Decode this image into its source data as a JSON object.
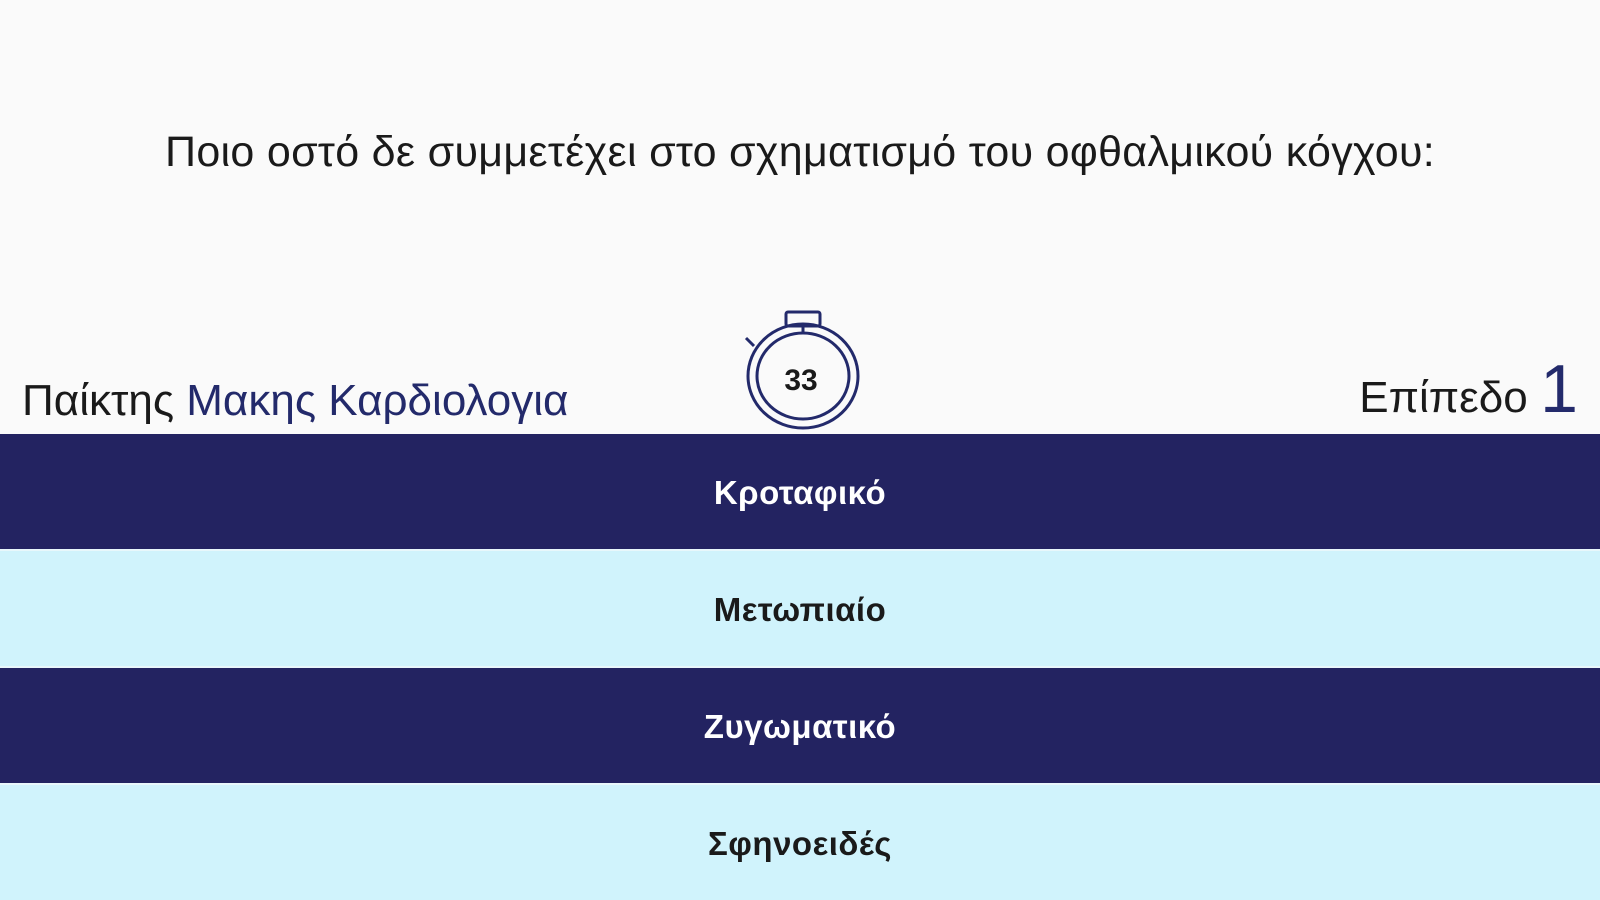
{
  "question": {
    "text": "Ποιο οστό δε συμμετέχει στο σχηματισμό του οφθαλμικού κόγχου:"
  },
  "player": {
    "label": "Παίκτης",
    "name": "Μακης Καρδιολογια"
  },
  "timer": {
    "value": "33",
    "icon": "stopwatch-icon"
  },
  "level": {
    "label": "Επίπεδο",
    "number": "1"
  },
  "answers": [
    {
      "label": "Κροταφικό"
    },
    {
      "label": "Μετωπιαίο"
    },
    {
      "label": "Ζυγωματικό"
    },
    {
      "label": "Σφηνοειδές"
    }
  ],
  "colors": {
    "dark_answer_bg": "#232361",
    "light_answer_bg": "#d0f3fc",
    "accent_text": "#232a6b",
    "background": "#fafafa"
  }
}
